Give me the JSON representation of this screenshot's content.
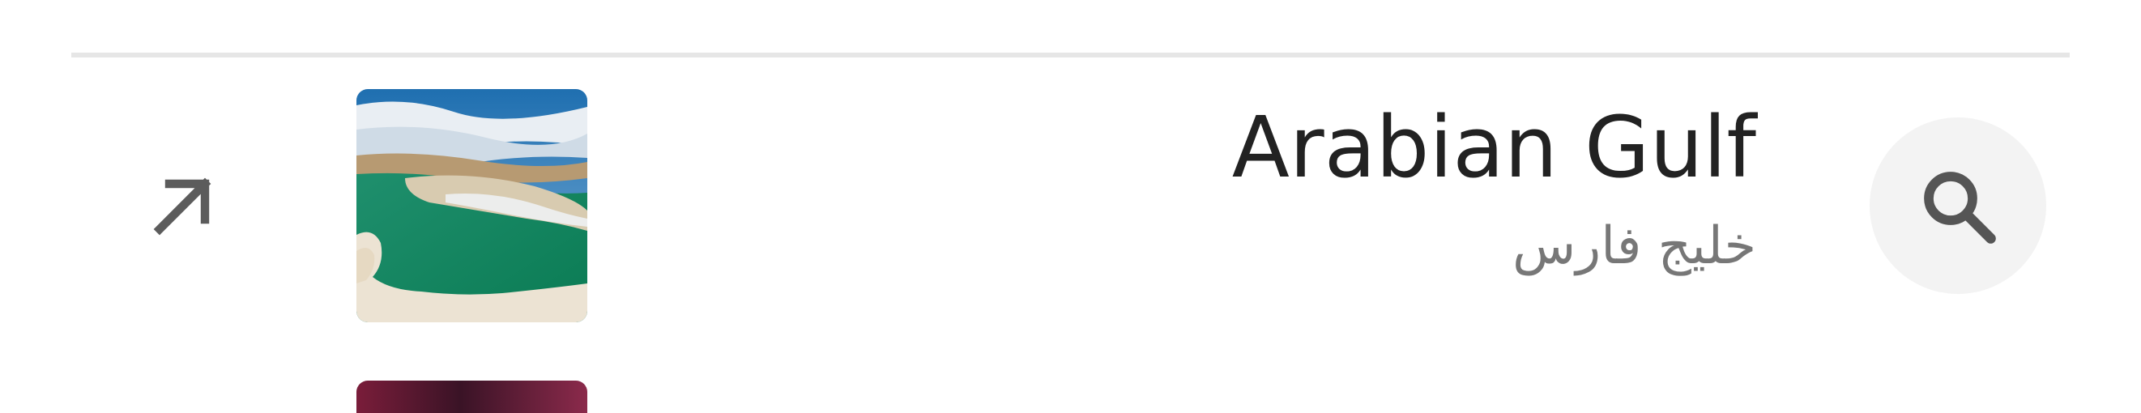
{
  "suggestion": {
    "title": "Arabian Gulf",
    "subtitle": "خليج فارس",
    "thumbnail": "persian-gulf-satellite-image",
    "left_icon": "arrow-up-left-icon",
    "right_icon": "search-icon"
  },
  "colors": {
    "divider": "#e6e6e6",
    "title_text": "#222222",
    "subtitle_text": "#777777",
    "icon": "#555555",
    "search_button_bg": "#f3f3f3"
  }
}
